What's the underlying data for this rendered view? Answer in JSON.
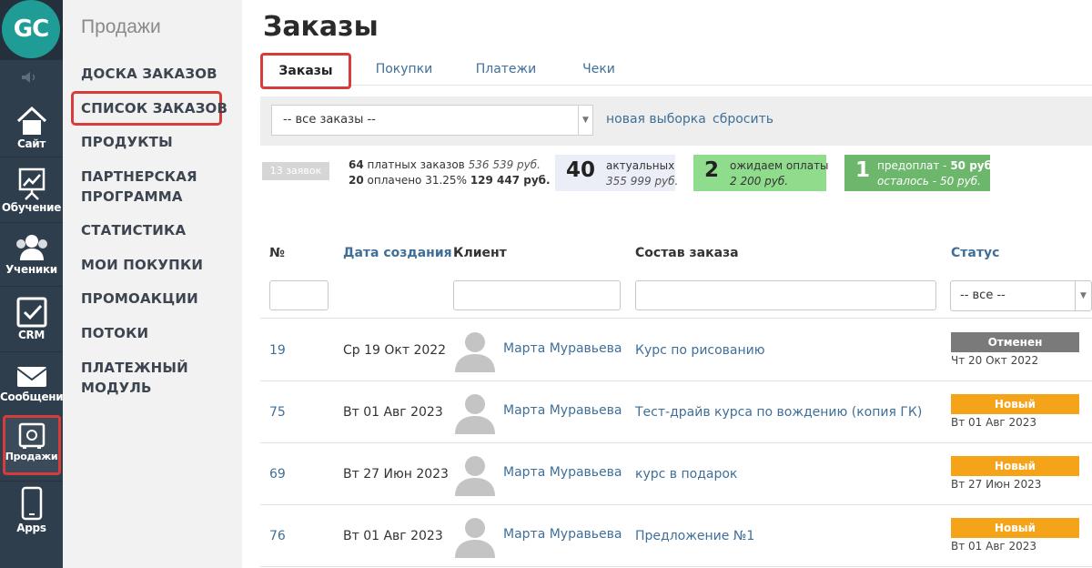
{
  "app": {
    "logo_text": "GC",
    "sidebar_icons": [
      {
        "label": "Сайт",
        "icon": "house-icon"
      },
      {
        "label": "Обучение",
        "icon": "presentation-chart-icon"
      },
      {
        "label": "Ученики",
        "icon": "users-icon"
      },
      {
        "label": "CRM",
        "icon": "checkbox-icon"
      },
      {
        "label": "Сообщения",
        "icon": "envelope-icon"
      },
      {
        "label": "Продажи",
        "icon": "safe-icon"
      },
      {
        "label": "Apps",
        "icon": "phone-icon"
      }
    ]
  },
  "menu": {
    "title": "Продажи",
    "items": [
      {
        "label": "ДОСКА ЗАКАЗОВ"
      },
      {
        "label": "СПИСОК ЗАКАЗОВ"
      },
      {
        "label": "ПРОДУКТЫ"
      },
      {
        "label": "ПАРТНЕРСКАЯ"
      },
      {
        "label": "ПРОГРАММА"
      },
      {
        "label": "СТАТИСТИКА"
      },
      {
        "label": "МОИ ПОКУПКИ"
      },
      {
        "label": "ПРОМОАКЦИИ"
      },
      {
        "label": "ПОТОКИ"
      },
      {
        "label": "ПЛАТЕЖНЫЙ МОДУЛЬ"
      }
    ]
  },
  "page": {
    "title": "Заказы",
    "tabs": [
      {
        "label": "Заказы"
      },
      {
        "label": "Покупки"
      },
      {
        "label": "Платежи"
      },
      {
        "label": "Чеки"
      }
    ]
  },
  "filter": {
    "select_value": "-- все заказы --",
    "new_selection": "новая выборка",
    "reset": "сбросить"
  },
  "stats": {
    "orders_count_badge": "13 заявок",
    "paid_orders_count": "64",
    "paid_orders_label": "платных заказов",
    "paid_orders_sum": "536 539 руб.",
    "paid_count": "20",
    "paid_label": "оплачено 31.25%",
    "paid_sum": "129 447 руб.",
    "actual_count": "40",
    "actual_label": "актуальных",
    "actual_sum": "355 999 руб.",
    "awaiting_count": "2",
    "awaiting_label": "ожидаем оплаты",
    "awaiting_sum": "2 200 руб.",
    "prepay_count": "1",
    "prepay_label": "предоплат -",
    "prepay_sum": "50 руб.",
    "left_label": "осталось -",
    "left_sum": "50 руб."
  },
  "table": {
    "columns": [
      "№",
      "Дата создания",
      "Клиент",
      "Состав заказа",
      "Статус"
    ],
    "status_filter": "-- все --",
    "rows": [
      {
        "num": "19",
        "date": "Ср 19 Окт 2022",
        "client": "Марта Муравьева",
        "order": "Курс по рисованию",
        "status": "Отменен",
        "status_color": "#7a7a7a",
        "status_date": "Чт 20 Окт 2022"
      },
      {
        "num": "75",
        "date": "Вт 01 Авг 2023",
        "client": "Марта Муравьева",
        "order": "Тест-драйв курса по вождению (копия ГК)",
        "status": "Новый",
        "status_color": "#f5a318",
        "status_date": "Вт 01 Авг 2023"
      },
      {
        "num": "69",
        "date": "Вт 27 Июн 2023",
        "client": "Марта Муравьева",
        "order": "курс в подарок",
        "status": "Новый",
        "status_color": "#f5a318",
        "status_date": "Вт 27 Июн 2023"
      },
      {
        "num": "76",
        "date": "Вт 01 Авг 2023",
        "client": "Марта Муравьева",
        "order": "Предложение №1",
        "status": "Новый",
        "status_color": "#f5a318",
        "status_date": "Вт 01 Авг 2023"
      }
    ]
  }
}
